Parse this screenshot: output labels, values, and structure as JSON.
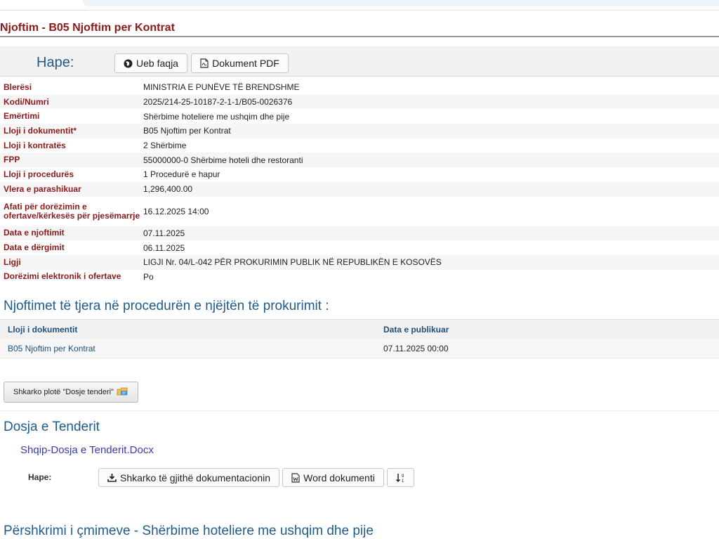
{
  "page": {
    "title": "Njoftim - B05 Njoftim per Kontrat"
  },
  "open_bar": {
    "label": "Hape:",
    "web_button": "Ueb faqja",
    "pdf_button": "Dokument PDF"
  },
  "details": {
    "buyer_label": "Blerësi",
    "buyer_value": "MINISTRIA E PUNËVE TË BRENDSHME",
    "code_label": "Kodi/Numri",
    "code_value": "2025/214-25-10187-2-1-1/B05-0026376",
    "name_label": "Emërtimi",
    "name_value": "Shërbime hoteliere me ushqim dhe pije",
    "doctype_label": "Lloji i dokumentit*",
    "doctype_value": "B05 Njoftim per Kontrat",
    "contract_label": "Lloji i kontratës",
    "contract_value": "2 Shërbime",
    "fpp_label": "FPP",
    "fpp_value": "55000000-0 Shërbime hoteli dhe restoranti",
    "procedure_label": "Lloji i procedurës",
    "procedure_value": "1 Procedurë e hapur",
    "value_label": "Vlera e parashikuar",
    "value_value": "1,296,400.00",
    "deadline_label": "Afati për dorëzimin e ofertave/kërkesës për pjesëmarrje",
    "deadline_value": "16.12.2025 14:00",
    "notice_date_label": "Data e njoftimit",
    "notice_date_value": "07.11.2025",
    "sent_date_label": "Data e dërgimit",
    "sent_date_value": "06.11.2025",
    "law_label": "Ligji",
    "law_value": "LIGJI Nr. 04/L-042 PËR PROKURIMIN PUBLIK NË REPUBLIKËN E KOSOVËS",
    "electronic_label": "Dorëzimi elektronik i ofertave",
    "electronic_value": "Po"
  },
  "other_notices": {
    "heading": "Njoftimet të tjera në procedurën e njëjtën të prokurimit :",
    "col_type": "Lloji i dokumentit",
    "col_date": "Data e publikuar",
    "rows": [
      {
        "type": "B05 Njoftim per Kontrat",
        "date": "07.11.2025 00:00"
      }
    ]
  },
  "download_all": {
    "label": "Shkarko plotë \"Dosje tenderi\""
  },
  "tender_file": {
    "heading": "Dosja e Tenderit",
    "doc_link": "Shqip-Dosja e Tenderit.Docx",
    "open_label": "Hape:",
    "download_button": "Shkarko të gjithë dokumentacionin",
    "word_button": "Word dokumenti"
  },
  "prices": {
    "heading": "Përshkrimi i çmimeve - Shërbime hoteliere me ushqim dhe pije"
  },
  "colors": {
    "label_red": "#8b1a1a",
    "heading_blue": "#1f5c8b",
    "link_blue": "#1f4f7a"
  },
  "icons": [
    "globe-icon",
    "pdf-icon",
    "folder-icon",
    "download-icon",
    "word-icon",
    "sort-icon"
  ]
}
